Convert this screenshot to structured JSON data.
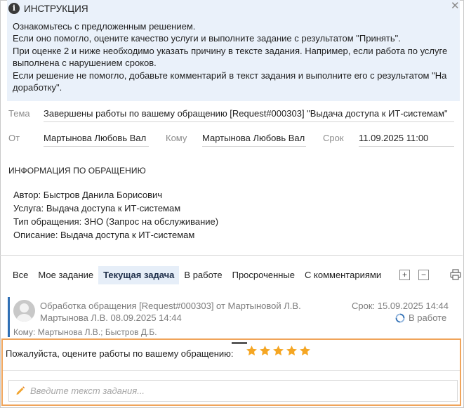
{
  "instruction": {
    "title": "ИНСТРУКЦИЯ",
    "lines": [
      "Ознакомьтесь с предложенным решением.",
      "Если оно помогло, оцените качество услуги и выполните задание с результатом \"Принять\".",
      "При оценке 2 и ниже необходимо указать причину в тексте задания. Например, если работа по услуге",
      "выполнена с нарушением сроков.",
      "Если решение не помогло, добавьте комментарий в текст задания и выполните его с результатом \"На",
      "доработку\"."
    ]
  },
  "fields": {
    "subject_label": "Тема",
    "subject": "Завершены работы по вашему обращению [Request#000303] \"Выдача доступа к ИТ-системам\"",
    "from_label": "От",
    "from": "Мартынова Любовь Вал",
    "to_label": "Кому",
    "to": "Мартынова Любовь Вал",
    "deadline_label": "Срок",
    "deadline": "11.09.2025 11:00"
  },
  "request_info": {
    "title": "ИНФОРМАЦИЯ ПО ОБРАЩЕНИЮ",
    "author": "Автор: Быстров Данила Борисович",
    "service": "Услуга: Выдача доступа к ИТ-системам",
    "type": "Тип обращения: ЗНО (Запрос на обслуживание)",
    "description": "Описание: Выдача доступа к ИТ-системам"
  },
  "tabs": [
    {
      "label": "Все",
      "active": false
    },
    {
      "label": "Мое задание",
      "active": false
    },
    {
      "label": "Текущая задача",
      "active": true
    },
    {
      "label": "В работе",
      "active": false
    },
    {
      "label": "Просроченные",
      "active": false
    },
    {
      "label": "С комментариями",
      "active": false
    }
  ],
  "toolbar": {
    "expand_label": "+",
    "collapse_label": "−"
  },
  "task": {
    "title": "Обработка обращения [Request#000303] от Мартыновой Л.В.",
    "deadline": "Срок: 15.09.2025 14:44",
    "author_date": "Мартынова Л.В.  08.09.2025 14:44",
    "status": "В работе",
    "to": "Кому: Мартынова Л.В.; Быстров Д.Б."
  },
  "rating": {
    "label": "Пожалуйста, оцените работы по вашему обращению:",
    "value": 5,
    "max": 5
  },
  "task_input": {
    "placeholder": "Введите текст задания...",
    "value": ""
  },
  "colors": {
    "accent": "#2f6fb5",
    "star": "#f5a623",
    "highlight_border": "#f0a45a",
    "info_bg": "#eaf1fa"
  }
}
